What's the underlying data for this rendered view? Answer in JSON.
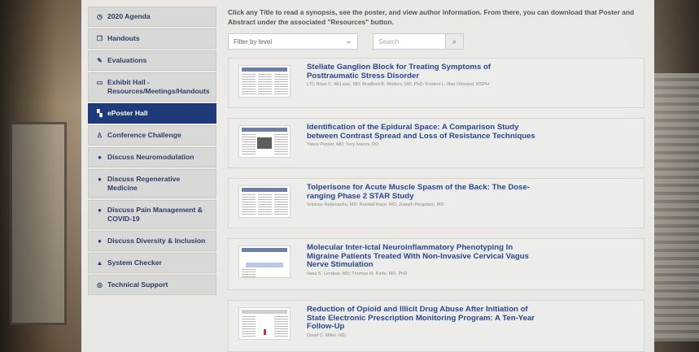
{
  "sidebar": {
    "items": [
      {
        "icon": "clock-icon",
        "glyph": "◷",
        "label": "2020 Agenda",
        "active": false
      },
      {
        "icon": "copy-icon",
        "glyph": "❐",
        "label": "Handouts",
        "active": false
      },
      {
        "icon": "edit-icon",
        "glyph": "✎",
        "label": "Evaluations",
        "active": false
      },
      {
        "icon": "id-card-icon",
        "glyph": "▭",
        "label": "Exhibit Hall - Resources/Meetings/Handouts",
        "active": false
      },
      {
        "icon": "map-icon",
        "glyph": "▚",
        "label": "ePoster Hall",
        "active": true
      },
      {
        "icon": "award-icon",
        "glyph": "♙",
        "label": "Conference Challenge",
        "active": false
      },
      {
        "icon": "comment-icon",
        "glyph": "●",
        "label": "Discuss Neuromodulation",
        "active": false
      },
      {
        "icon": "comment-icon",
        "glyph": "●",
        "label": "Discuss Regenerative Medicine",
        "active": false
      },
      {
        "icon": "comment-icon",
        "glyph": "●",
        "label": "Discuss Pain Management & COVID-19",
        "active": false
      },
      {
        "icon": "comment-icon",
        "glyph": "●",
        "label": "Discuss Diversity & Inclusion",
        "active": false
      },
      {
        "icon": "warning-icon",
        "glyph": "▲",
        "label": "System Checker",
        "active": false
      },
      {
        "icon": "support-icon",
        "glyph": "◎",
        "label": "Technical Support",
        "active": false
      }
    ]
  },
  "main": {
    "intro": "Click any Title to read a synopsis, see the poster, and view author information. From there, you can download that Poster and Abstract under the associated \"Resources\" button.",
    "filter_select": "Filter by level",
    "search_placeholder": "Search",
    "posters": [
      {
        "title": "Stellate Ganglion Block for Treating Symptoms of Posttraumatic Stress Disorder",
        "authors": "LTC Brian C. McLean, MD; Bradford B. Walters, MD, PhD; Kristine L. Rae Olmsted, MSPH"
      },
      {
        "title": "Identification of the Epidural Space: A Comparison Study between Contrast Spread and Loss of Resistance Techniques",
        "authors": "Yakov Perper, MD; Yury Ivanov, DO"
      },
      {
        "title": "Tolperisone for Acute Muscle Spasm of the Back: The Dose-ranging Phase 2 STAR Study",
        "authors": "Srinivas Nalamachu, MD; Randall Kaye, MD; Joseph Pergolizzi, MD"
      },
      {
        "title": "Molecular Inter-Ictal Neuroinflammatory Phenotyping In Migraine Patients Treated With Non-Invasive Cervical Vagus Nerve Stimulation",
        "authors": "Ilana S. Lenduai, MD; Thomas M. Kinfe, MD, PhD"
      },
      {
        "title": "Reduction of Opioid and Illicit Drug Abuse After Initiation of State Electronic Prescription Monitoring Program: A Ten-Year Follow-Up",
        "authors": "David C. Miller, MD"
      }
    ]
  }
}
